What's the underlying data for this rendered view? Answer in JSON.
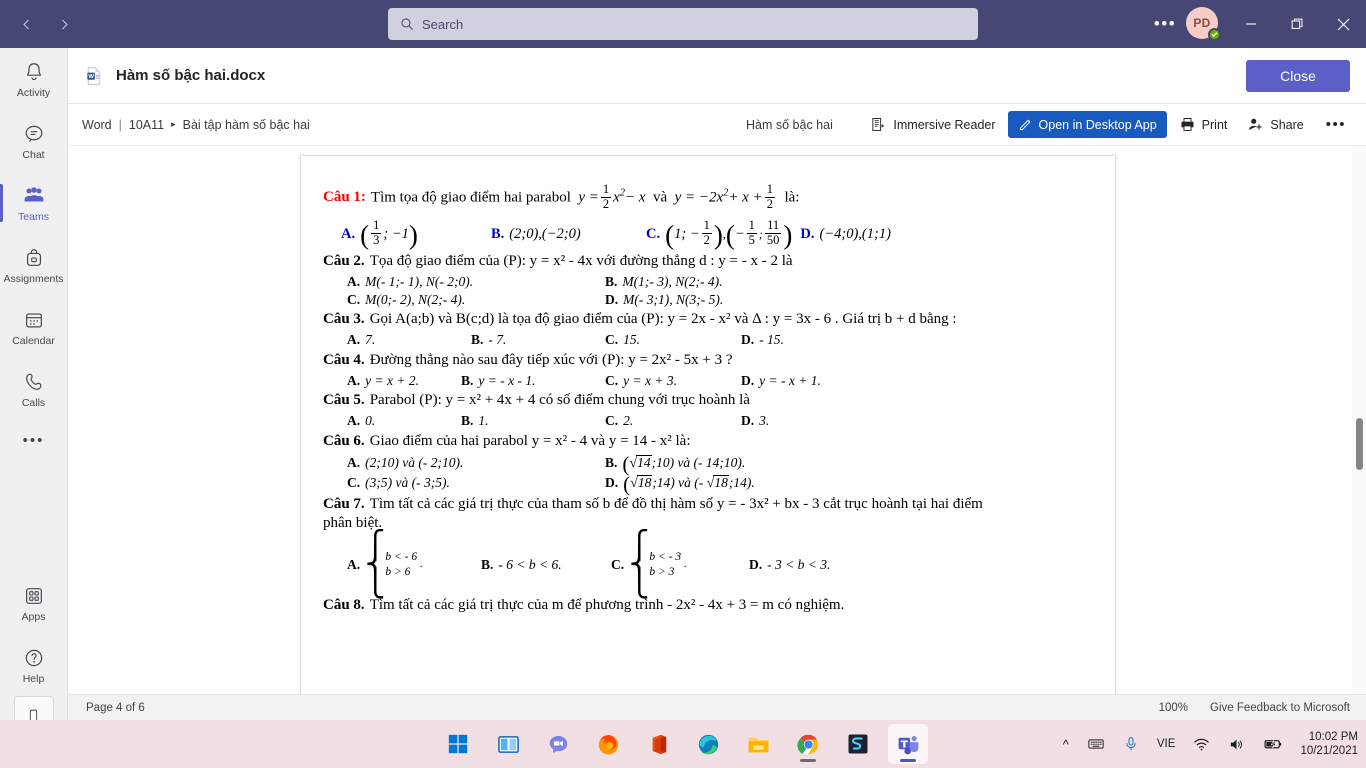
{
  "titlebar": {
    "back_icon": "chevron-left-icon",
    "forward_icon": "chevron-right-icon",
    "search_placeholder": "Search",
    "more_label": "•••",
    "avatar_initials": "PD",
    "minimize_label": "Minimize",
    "maximize_label": "Restore",
    "close_label": "Close",
    "bg_color": "#464775"
  },
  "rail": {
    "items": [
      {
        "label": "Activity",
        "icon": "bell-icon",
        "active": false
      },
      {
        "label": "Chat",
        "icon": "chat-icon",
        "active": false
      },
      {
        "label": "Teams",
        "icon": "teams-people-icon",
        "active": true
      },
      {
        "label": "Assignments",
        "icon": "backpack-icon",
        "active": false
      },
      {
        "label": "Calendar",
        "icon": "calendar-icon",
        "active": false
      },
      {
        "label": "Calls",
        "icon": "phone-handset-icon",
        "active": false
      }
    ],
    "more_label": "•••",
    "bottom": [
      {
        "label": "Apps",
        "icon": "apps-grid-icon"
      },
      {
        "label": "Help",
        "icon": "question-circle-icon"
      }
    ],
    "phone_icon": "mobile-device-icon",
    "accent_color": "#5b5fc7"
  },
  "dochead": {
    "file_icon": "word-doc-icon",
    "file_name": "Hàm số bậc hai.docx",
    "close_button": "Close"
  },
  "toolbar": {
    "app_name": "Word",
    "separator": "|",
    "team_name": "10A11",
    "caret": "▸",
    "channel_name": "Bài tập hàm số bậc hai",
    "center_title": "Hàm số bậc hai",
    "immersive_reader": "Immersive Reader",
    "open_desktop": "Open in Desktop App",
    "print": "Print",
    "share": "Share",
    "overflow": "•••",
    "primary_color": "#185abd"
  },
  "statusbar": {
    "page_indicator": "Page 4 of 6",
    "zoom": "100%",
    "feedback": "Give Feedback to Microsoft"
  },
  "taskbar": {
    "icons": [
      {
        "name": "windows-start-icon",
        "running": false,
        "active": false
      },
      {
        "name": "task-view-icon",
        "running": false,
        "active": false
      },
      {
        "name": "chat-teams-consumer-icon",
        "running": false,
        "active": false
      },
      {
        "name": "firefox-icon",
        "running": false,
        "active": false
      },
      {
        "name": "microsoft-office-icon",
        "running": false,
        "active": false
      },
      {
        "name": "microsoft-edge-icon",
        "running": false,
        "active": false
      },
      {
        "name": "file-explorer-icon",
        "running": false,
        "active": false
      },
      {
        "name": "google-chrome-icon",
        "running": true,
        "active": false
      },
      {
        "name": "snipaste-icon",
        "running": false,
        "active": false
      },
      {
        "name": "microsoft-teams-icon",
        "running": true,
        "active": true
      }
    ],
    "tray": {
      "chevron": "^",
      "keyboard_icon": "keyboard-icon",
      "mic_icon": "microphone-icon",
      "language": "VIE",
      "wifi_icon": "wifi-icon",
      "volume_icon": "speaker-icon",
      "battery_icon": "battery-charging-icon",
      "time": "10:02 PM",
      "date": "10/21/2021"
    },
    "bg_color": "#f2dfe3"
  },
  "document": {
    "q1": {
      "num": "Câu 1:",
      "text_a": "Tìm tọa độ giao điểm hai parabol",
      "eq1_lead": "y =",
      "eq1_frac_num": "1",
      "eq1_frac_den": "2",
      "eq1_tail": "x",
      "eq1_exp": "2",
      "eq1_minus": "− x",
      "conj": "và",
      "eq2_lead": "y = −2x",
      "eq2_exp": "2",
      "eq2_mid": "+ x +",
      "eq2_frac_num": "1",
      "eq2_frac_den": "2",
      "text_b": "là:",
      "optA_label": "A.",
      "optA_n": "1",
      "optA_d": "3",
      "optA_rest": "; −1",
      "optB_label": "B.",
      "optB_val": "(2;0),(−2;0)",
      "optC_label": "C.",
      "optC_p1": "1; −",
      "optC_n1": "1",
      "optC_d1": "2",
      "optC_p2a": "−",
      "optC_n2": "1",
      "optC_d2": "5",
      "optC_semi": ";",
      "optC_n3": "11",
      "optC_d3": "50",
      "optD_label": "D.",
      "optD_val": "(−4;0),(1;1)"
    },
    "q2": {
      "num": "Câu 2.",
      "text": "Tọa độ giao điểm của (P): y = x² - 4x  với đường thẳng d : y = - x - 2  là",
      "options": [
        {
          "label": "A.",
          "value": "M(- 1;- 1), N(- 2;0)."
        },
        {
          "label": "B.",
          "value": "M(1;- 3), N(2;- 4)."
        },
        {
          "label": "C.",
          "value": "M(0;- 2), N(2;- 4)."
        },
        {
          "label": "D.",
          "value": "M(- 3;1), N(3;- 5)."
        }
      ]
    },
    "q3": {
      "num": "Câu 3.",
      "text": "Gọi A(a;b) và B(c;d) là tọa độ giao điểm của (P): y = 2x - x² và Δ : y = 3x - 6 . Giá trị  b + d  bằng :",
      "options": [
        {
          "label": "A.",
          "value": "7."
        },
        {
          "label": "B.",
          "value": "- 7."
        },
        {
          "label": "C.",
          "value": "15."
        },
        {
          "label": "D.",
          "value": "- 15."
        }
      ]
    },
    "q4": {
      "num": "Câu 4.",
      "text": "Đường thẳng nào sau đây tiếp xúc với (P): y = 2x² - 5x + 3 ?",
      "options": [
        {
          "label": "A.",
          "value": "y = x + 2."
        },
        {
          "label": "B.",
          "value": "y = - x - 1."
        },
        {
          "label": "C.",
          "value": "y = x + 3."
        },
        {
          "label": "D.",
          "value": "y = - x + 1."
        }
      ]
    },
    "q5": {
      "num": "Câu 5.",
      "text": "Parabol (P): y = x² + 4x + 4  có số điểm chung với trục hoành là",
      "options": [
        {
          "label": "A.",
          "value": "0."
        },
        {
          "label": "B.",
          "value": "1."
        },
        {
          "label": "C.",
          "value": "2."
        },
        {
          "label": "D.",
          "value": "3."
        }
      ]
    },
    "q6": {
      "num": "Câu 6.",
      "text": "Giao điểm của hai parabol y = x² - 4 và y = 14 - x²  là:",
      "optA_label": "A.",
      "optA_val": "(2;10) và (- 2;10).",
      "optB_label": "B.",
      "optB_pre": "(",
      "optB_rad": "14",
      "optB_post": ";10) và (- 14;10).",
      "optC_label": "C.",
      "optC_val": "(3;5) và (- 3;5).",
      "optD_label": "D.",
      "optD_pre": "(",
      "optD_rad": "18",
      "optD_mid": ";14) và (-",
      "optD_rad2": "18",
      "optD_post": ";14)."
    },
    "q7": {
      "num": "Câu 7.",
      "text_line1": "Tìm tất cả các giá trị thực của tham số b  để đồ thị hàm số  y = - 3x² + bx - 3 cắt trục hoành tại hai điểm",
      "text_line2": "phân biệt.",
      "optA_label": "A.",
      "optA_top": "b < - 6",
      "optA_bot": "b > 6",
      "optB_label": "B.",
      "optB_val": "- 6 < b < 6.",
      "optC_label": "C.",
      "optC_top": "b < - 3",
      "optC_bot": "b > 3",
      "optD_label": "D.",
      "optD_val": "- 3 < b < 3."
    },
    "q8": {
      "num": "Câu 8.",
      "text": "Tìm tất cả các giá trị thực của m  để phương trình - 2x² - 4x + 3 = m  có nghiệm."
    }
  }
}
